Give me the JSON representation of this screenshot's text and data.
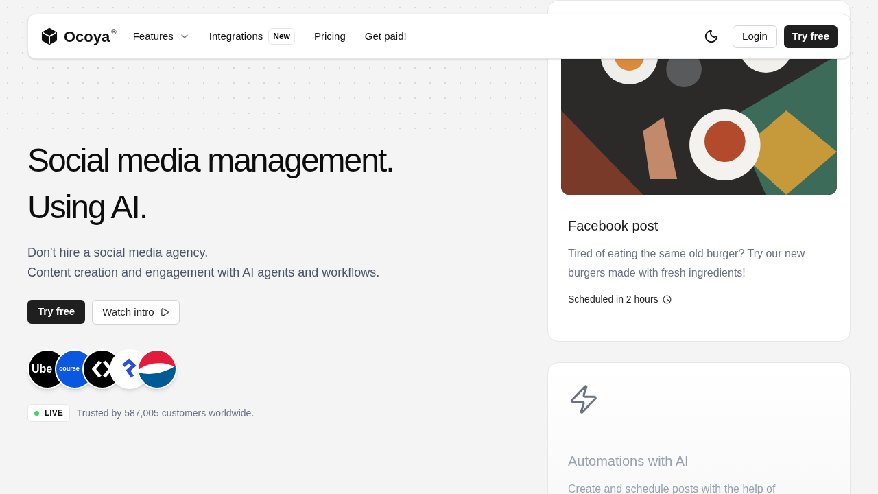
{
  "nav": {
    "brand": "Ocoya",
    "brand_mark": "®",
    "links": [
      {
        "label": "Features",
        "kind": "dropdown"
      },
      {
        "label": "Integrations",
        "kind": "badge",
        "badge": "New"
      },
      {
        "label": "Pricing",
        "kind": "plain"
      },
      {
        "label": "Get paid!",
        "kind": "plain"
      }
    ],
    "login": "Login",
    "try_free": "Try free"
  },
  "hero": {
    "headline": [
      "Social media management.",
      "Using AI."
    ],
    "subtitle": [
      "Don't hire a social media agency.",
      "Content creation and engagement with AI agents and workflows."
    ],
    "primary": "Try free",
    "secondary": "Watch intro",
    "logos": [
      {
        "kind": "text",
        "text": "Ube",
        "color": "#000000"
      },
      {
        "kind": "text",
        "text": "course",
        "color": "#0b57e0"
      },
      {
        "kind": "chevrons",
        "color": "#000000"
      },
      {
        "kind": "mark",
        "color": "#ffffff"
      },
      {
        "kind": "globe",
        "color": "#ffffff"
      }
    ],
    "live": "LIVE",
    "trusted": "Trusted by 587,005 customers worldwide."
  },
  "cards": [
    {
      "kind": "post",
      "title": "Facebook post",
      "body": "Tired of eating the same old burger? Try our new burgers made with fresh ingredients!",
      "schedule": "Scheduled in 2 hours"
    },
    {
      "kind": "feature",
      "title": "Automations with AI",
      "body": "Create and schedule posts with the help of"
    }
  ]
}
